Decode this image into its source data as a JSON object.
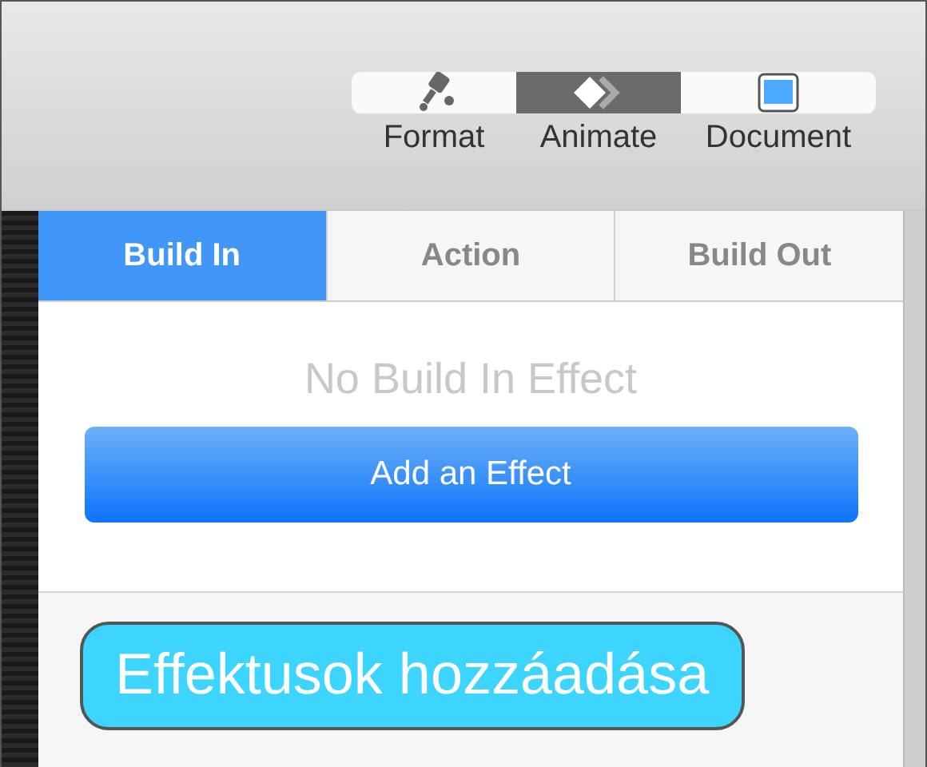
{
  "toolbar": [
    {
      "kind": "format",
      "label": "Format",
      "selected": false
    },
    {
      "kind": "animate",
      "label": "Animate",
      "selected": true
    },
    {
      "kind": "document",
      "label": "Document",
      "selected": false
    }
  ],
  "tabs": [
    {
      "label": "Build In",
      "selected": true
    },
    {
      "label": "Action",
      "selected": false
    },
    {
      "label": "Build Out",
      "selected": false
    }
  ],
  "empty_message": "No Build In Effect",
  "add_button": "Add an Effect",
  "callout": "Effektusok hozzáadása"
}
